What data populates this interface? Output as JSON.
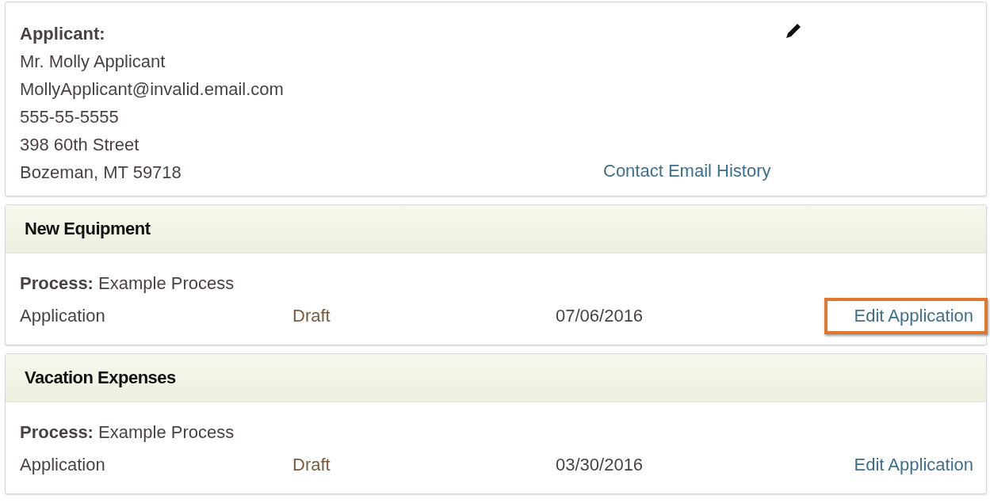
{
  "applicant": {
    "heading": "Applicant:",
    "lines": [
      "Mr. Molly Applicant",
      "MollyApplicant@invalid.email.com",
      "555-55-5555",
      "398 60th Street",
      "Bozeman, MT 59718"
    ],
    "link": "Contact Email History"
  },
  "applications": [
    {
      "title": "New Equipment",
      "process_label": "Process:",
      "process": "Example Process",
      "type": "Application",
      "status": "Draft",
      "date": "07/06/2016",
      "action": "Edit Application",
      "highlighted": true
    },
    {
      "title": "Vacation Expenses",
      "process_label": "Process:",
      "process": "Example Process",
      "type": "Application",
      "status": "Draft",
      "date": "03/30/2016",
      "action": "Edit Application",
      "highlighted": false
    }
  ]
}
